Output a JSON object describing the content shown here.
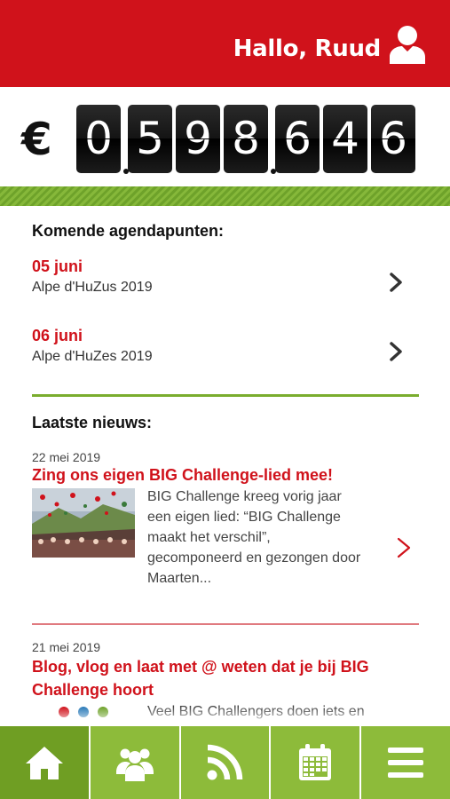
{
  "header": {
    "greeting": "Hallo, Ruud",
    "user_icon": "user-icon"
  },
  "counter": {
    "currency": "€",
    "digits": [
      "0",
      "5",
      "9",
      "8",
      "6",
      "4",
      "6"
    ]
  },
  "agenda": {
    "title": "Komende agendapunten:",
    "items": [
      {
        "date": "05 juni",
        "label": "Alpe d'HuZus 2019"
      },
      {
        "date": "06 juni",
        "label": "Alpe d'HuZes 2019"
      }
    ]
  },
  "news": {
    "title": "Laatste nieuws:",
    "items": [
      {
        "date": "22 mei 2019",
        "headline": "Zing ons eigen BIG Challenge-lied mee!",
        "excerpt": [
          "BIG Challenge kreeg vorig jaar",
          "een eigen lied: “BIG Challenge",
          "maakt het verschil”,",
          "gecomponeerd en gezongen door",
          "Maarten..."
        ]
      },
      {
        "date": "21 mei 2019",
        "headline": "Blog, vlog en laat met @ weten dat je bij BIG Challenge hoort",
        "excerpt": [
          "Veel BIG Challengers doen iets en"
        ]
      }
    ]
  },
  "tabbar": {
    "tabs": [
      {
        "icon": "home-icon",
        "active": true
      },
      {
        "icon": "group-icon",
        "active": false
      },
      {
        "icon": "rss-icon",
        "active": false
      },
      {
        "icon": "calendar-icon",
        "active": false
      },
      {
        "icon": "menu-icon",
        "active": false
      }
    ]
  },
  "colors": {
    "brand_red": "#d0121b",
    "brand_green": "#8dbb3a",
    "active_green": "#6f9e23"
  }
}
